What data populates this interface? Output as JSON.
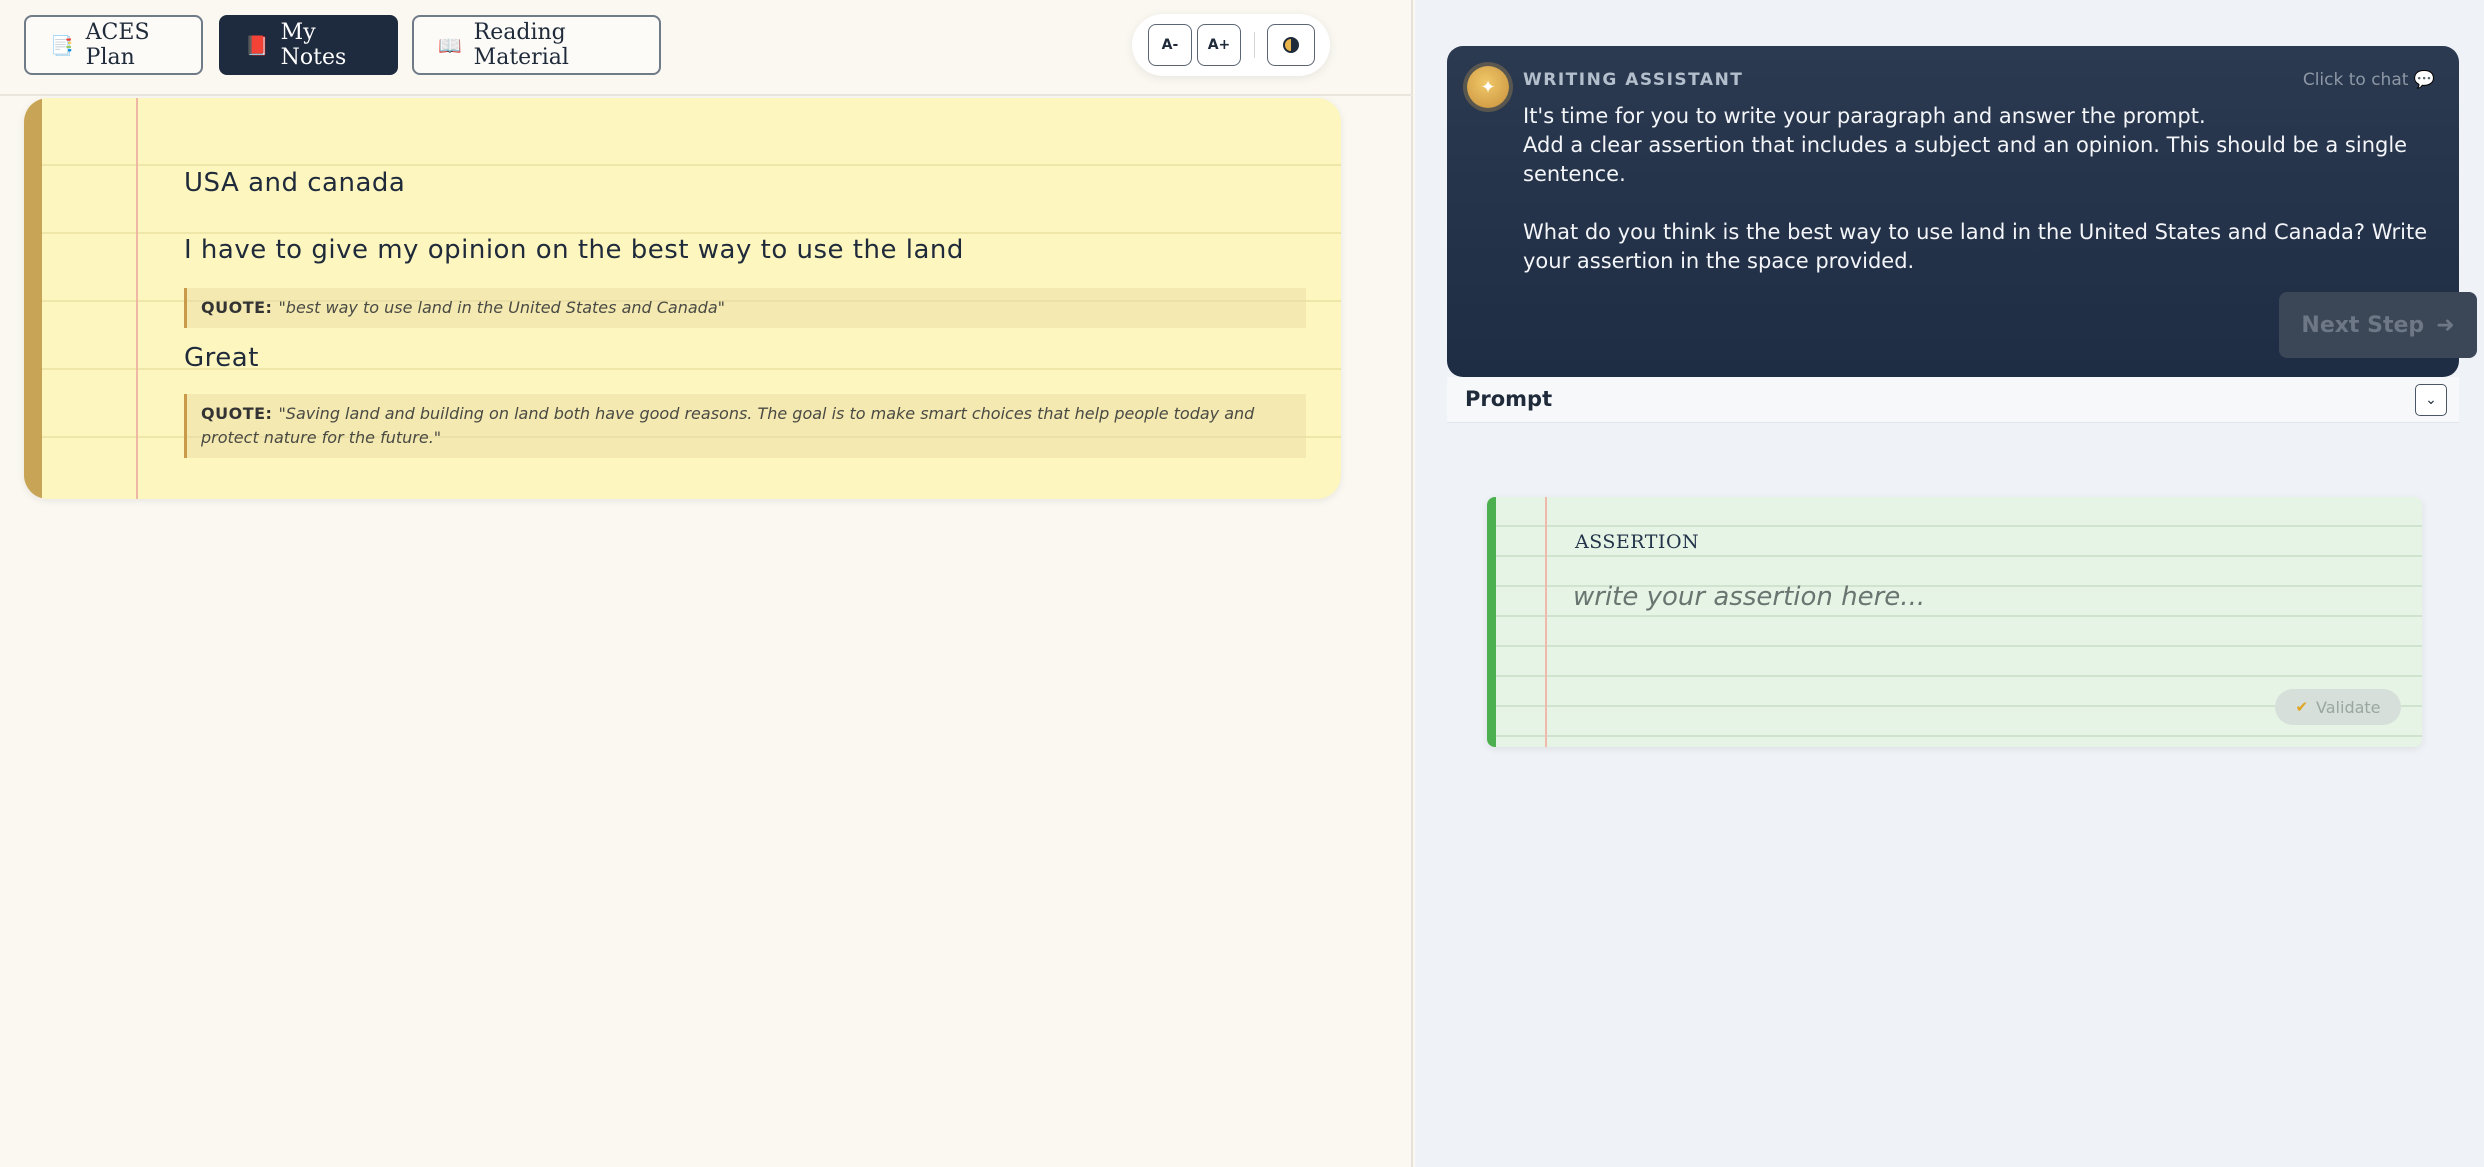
{
  "tabs": [
    {
      "icon": "📑",
      "label": "ACES Plan"
    },
    {
      "icon": "📕",
      "label": "My Notes"
    },
    {
      "icon": "📖",
      "label": "Reading Material"
    }
  ],
  "toolbar": {
    "decrease_font_label": "A-",
    "increase_font_label": "A+",
    "contrast_icon": "contrast-icon"
  },
  "notes": {
    "title": "USA and canada",
    "line2": "I have to give my opinion on the best way to use the land",
    "quote1": {
      "label": "QUOTE:",
      "text": "\"best way to use land in the United States and Canada\""
    },
    "line3": "Great",
    "quote2": {
      "label": "QUOTE:",
      "text": "\"Saving land and building on land both have good reasons. The goal is to make smart choices that help people today and protect nature for the future.\""
    }
  },
  "assistant": {
    "label": "WRITING ASSISTANT",
    "click_to_chat": "Click to chat",
    "line1": "It's time for you to write your paragraph and answer the prompt.",
    "line2": "Add a clear assertion that includes a subject and an opinion. This should be a single sentence.",
    "line3": "What do you think is the best way to use land in the United States and Canada? Write your assertion in the space provided.",
    "next_step": "Next Step"
  },
  "prompt": {
    "label": "Prompt"
  },
  "assertion": {
    "label": "ASSERTION",
    "placeholder": "write your assertion here...",
    "value": "",
    "validate": "Validate"
  },
  "colors": {
    "active_tab": "#1e2a3e",
    "notebook_bg": "#fdf6bf",
    "assistant_bg": "#1e2c44",
    "assertion_accent": "#4caf50"
  }
}
